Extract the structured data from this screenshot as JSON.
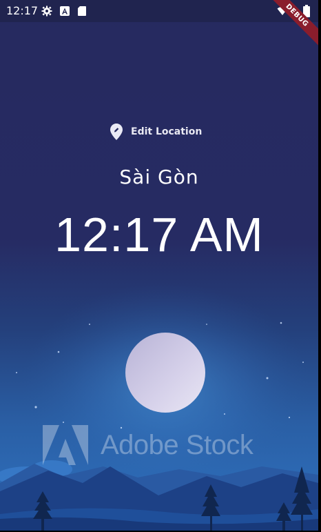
{
  "status_bar": {
    "time": "12:17",
    "left_icons": [
      "gear-icon",
      "a-badge-icon",
      "sd-card-icon"
    ],
    "right_icons": [
      "wifi-icon",
      "battery-icon"
    ]
  },
  "debug_banner": {
    "label": "DEBUG"
  },
  "main": {
    "edit_location_label": "Edit Location",
    "edit_location_icon": "location-pin-icon",
    "location_name": "Sài Gòn",
    "time": "12:17 AM"
  },
  "background": {
    "watermark_text": "Adobe Stock",
    "colors": {
      "sky_top": "#262a5f",
      "sky_bottom": "#2a6cb6",
      "moon": "#c9c4e4",
      "mountains": "#1b3f7c"
    }
  }
}
